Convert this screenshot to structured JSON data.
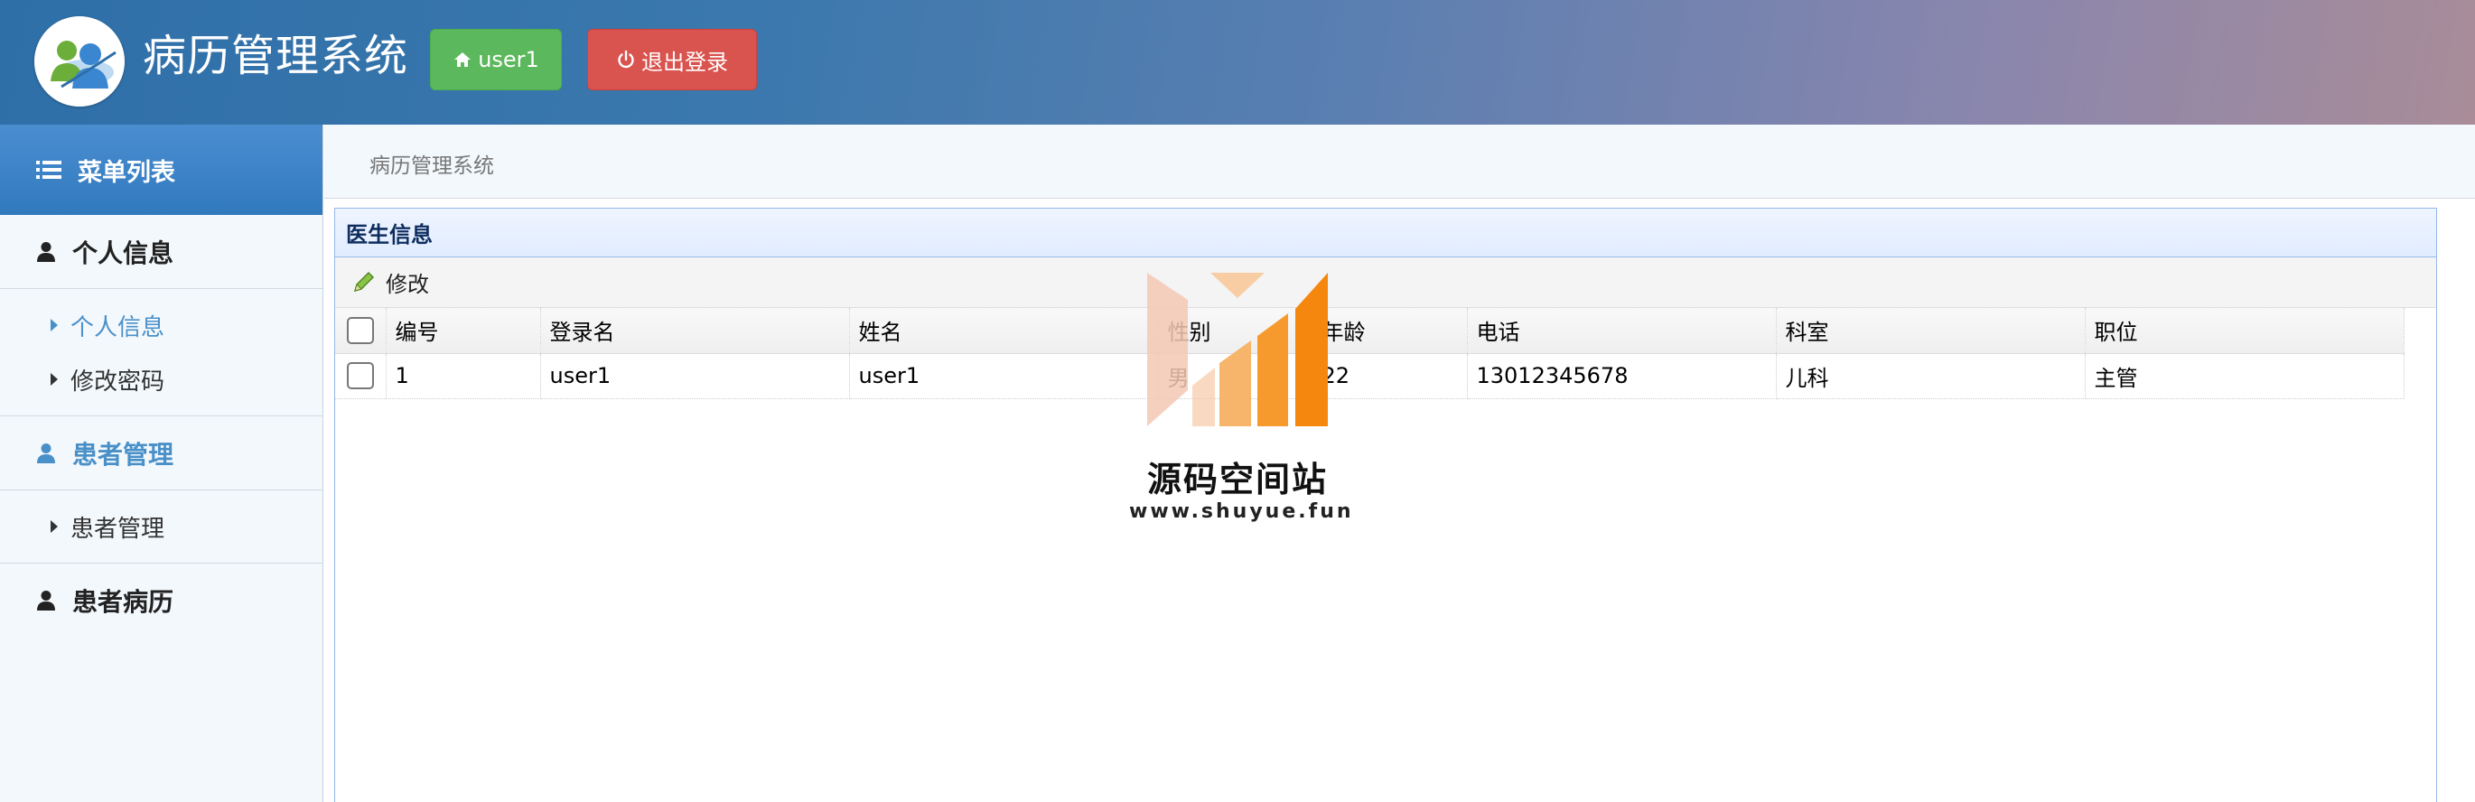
{
  "header": {
    "app_title": "病历管理系统",
    "user_button_label": "user1",
    "logout_button_label": "退出登录",
    "colors": {
      "user_button": "#5cb85c",
      "logout_button": "#d9534f"
    }
  },
  "sidebar": {
    "heading": "菜单列表",
    "groups": [
      {
        "label": "个人信息",
        "active": false,
        "items": [
          {
            "label": "个人信息",
            "active": true
          },
          {
            "label": "修改密码",
            "active": false
          }
        ]
      },
      {
        "label": "患者管理",
        "active": true,
        "items": [
          {
            "label": "患者管理",
            "active": false
          }
        ]
      },
      {
        "label": "患者病历",
        "active": false,
        "items": []
      }
    ],
    "colors": {
      "active": "#4a90c8"
    }
  },
  "breadcrumb": {
    "text": "病历管理系统"
  },
  "panel": {
    "title": "医生信息",
    "toolbar": {
      "edit_label": "修改"
    },
    "table": {
      "columns": [
        "编号",
        "登录名",
        "姓名",
        "性别",
        "年龄",
        "电话",
        "科室",
        "职位"
      ],
      "rows": [
        [
          "1",
          "user1",
          "user1",
          "男",
          "22",
          "13012345678",
          "儿科",
          "主管"
        ]
      ]
    }
  },
  "watermark": {
    "name": "源码空间站",
    "url": "www.shuyue.fun"
  }
}
